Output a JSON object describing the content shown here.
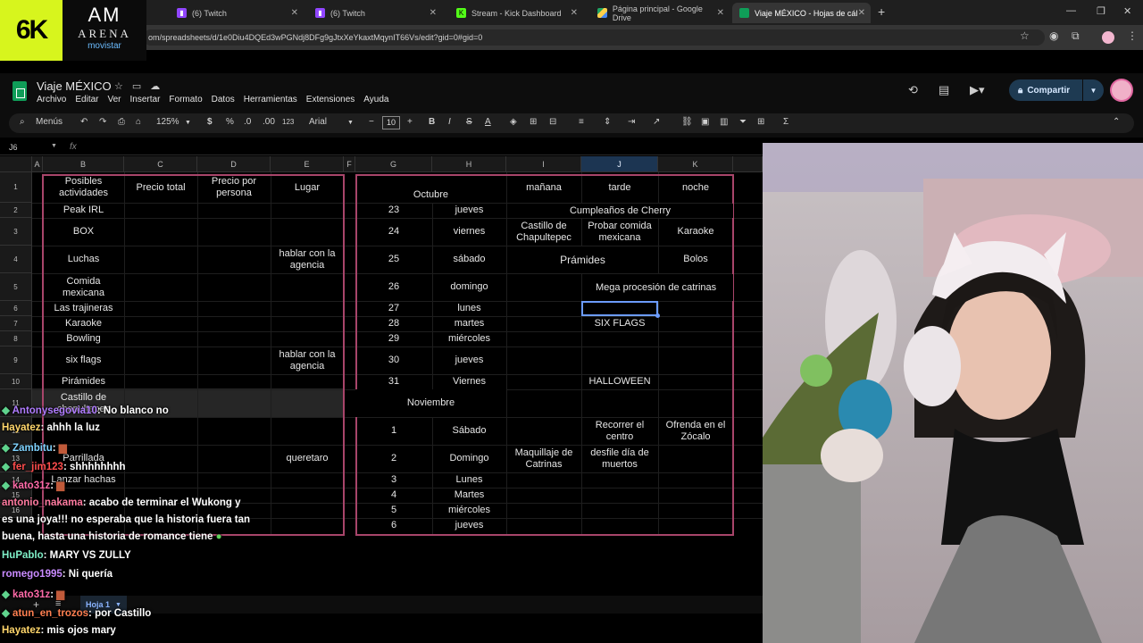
{
  "browser": {
    "tabs": [
      {
        "label": "(6) Twitch",
        "icon": "twitch-icon"
      },
      {
        "label": "(6) Twitch",
        "icon": "twitch-icon"
      },
      {
        "label": "Stream - Kick Dashboard",
        "icon": "kick-icon"
      },
      {
        "label": "Página principal - Google Drive",
        "icon": "drive-icon"
      },
      {
        "label": "Viaje MÉXICO - Hojas de cálcul",
        "icon": "sheets-icon"
      }
    ],
    "url": "om/spreadsheets/d/1e0Diu4DQEd3wPGNdj8DFg9gJtxXeYkaxtMqynIT66Vs/edit?gid=0#gid=0"
  },
  "overlay": {
    "logo_left": "6K",
    "logo_right_a": "AM",
    "logo_right_b": "ARENA",
    "logo_right_c": "movistar"
  },
  "sheet": {
    "title": "Viaje MÉXICO",
    "menu": [
      "Archivo",
      "Editar",
      "Ver",
      "Insertar",
      "Formato",
      "Datos",
      "Herramientas",
      "Extensiones",
      "Ayuda"
    ],
    "share_label": "Compartir",
    "toolbar": {
      "search": "Menús",
      "zoom": "125%",
      "currency": "$",
      "percent": "%",
      "dec_less": ".0",
      "dec_more": ".00",
      "number_fmt": "123",
      "font": "Arial",
      "font_size": "10"
    },
    "cell_ref": "J6",
    "fx": "fx",
    "columns": [
      "A",
      "B",
      "C",
      "D",
      "E",
      "F",
      "G",
      "H",
      "I",
      "J",
      "K"
    ],
    "rows": [
      "1",
      "2",
      "3",
      "4",
      "5",
      "6",
      "7",
      "8",
      "9",
      "10",
      "11",
      "12",
      "13",
      "14",
      "15",
      "16"
    ],
    "left_table": {
      "headers": [
        "Posibles actividades",
        "Precio total",
        "Precio por persona",
        "Lugar"
      ],
      "activities": [
        "Peak IRL",
        "BOX",
        "Luchas",
        "Comida mexicana",
        "Las trajineras",
        "Karaoke",
        "Bowling",
        "six flags",
        "Pirámides",
        "Castillo de chapultepec",
        "Parrillada",
        "Lanzar hachas"
      ],
      "lugar": [
        "hablar con la agencia",
        "hablar con la agencia",
        "queretaro"
      ]
    },
    "right_table": {
      "headers": [
        "mañana",
        "tarde",
        "noche"
      ],
      "month1": "Octubre",
      "month2": "Noviembre",
      "days_oct": [
        {
          "n": "23",
          "d": "jueves"
        },
        {
          "n": "24",
          "d": "viernes"
        },
        {
          "n": "25",
          "d": "sábado"
        },
        {
          "n": "26",
          "d": "domingo"
        },
        {
          "n": "27",
          "d": "lunes"
        },
        {
          "n": "28",
          "d": "martes"
        },
        {
          "n": "29",
          "d": "miércoles"
        },
        {
          "n": "30",
          "d": "jueves"
        },
        {
          "n": "31",
          "d": "Viernes"
        }
      ],
      "days_nov": [
        {
          "n": "1",
          "d": "Sábado"
        },
        {
          "n": "2",
          "d": "Domingo"
        },
        {
          "n": "3",
          "d": "Lunes"
        },
        {
          "n": "4",
          "d": "Martes"
        },
        {
          "n": "5",
          "d": "miércoles"
        },
        {
          "n": "6",
          "d": "jueves"
        }
      ],
      "events": {
        "cumple": "Cumpleaños de Cherry",
        "castillo": "Castillo de Chapultepec",
        "comida": "Probar comida mexicana",
        "karaoke": "Karaoke",
        "piramides": "Prámides",
        "bolos": "Bolos",
        "catrinas": "Mega procesión de catrinas",
        "sixflags": "SIX FLAGS",
        "halloween": "HALLOWEEN",
        "recorrer": "Recorrer el centro",
        "ofrenda": "Ofrenda en el Zócalo",
        "maquillaje": "Maquillaje de Catrinas",
        "desfile": "desfile día de muertos"
      }
    },
    "sheet_tab": "Hoja 1"
  },
  "chat": [
    {
      "user": "Antonysegovia10",
      "msg": ": No blanco no",
      "color": "#b07cff",
      "badge": true
    },
    {
      "user": "Hayatez",
      "msg": ": ahhh la luz",
      "color": "#ffd66b",
      "badge": false
    },
    {
      "user": "Zambitu",
      "msg": ": ",
      "color": "#7fd3ff",
      "badge": true
    },
    {
      "user": "fer_jim123",
      "msg": ": shhhhhhhh",
      "color": "#ff4d4d",
      "badge": true
    },
    {
      "user": "kato31z",
      "msg": ": ",
      "color": "#ff6aa8",
      "badge": true
    },
    {
      "user": "antonio_nakama",
      "msg": ": acabo de terminar el Wukong y",
      "color": "#ff7aa0",
      "badge": false
    },
    {
      "user": "",
      "msg": "es una joya!!! no esperaba que la historia fuera tan",
      "color": "#fff",
      "badge": false
    },
    {
      "user": "",
      "msg": "buena, hasta una historia de romance tiene",
      "color": "#fff",
      "badge": false
    },
    {
      "user": "HuPablo",
      "msg": ": MARY VS ZULLY",
      "color": "#7ff0c8",
      "badge": false
    },
    {
      "user": "romego1995",
      "msg": ": Ni quería",
      "color": "#c98bff",
      "badge": false
    },
    {
      "user": "kato31z",
      "msg": ": ",
      "color": "#ff6aa8",
      "badge": true
    },
    {
      "user": "atun_en_trozos",
      "msg": ": por Castillo",
      "color": "#ff7f50",
      "badge": true
    },
    {
      "user": "Hayatez",
      "msg": ": mis ojos mary",
      "color": "#ffd66b",
      "badge": false
    }
  ]
}
